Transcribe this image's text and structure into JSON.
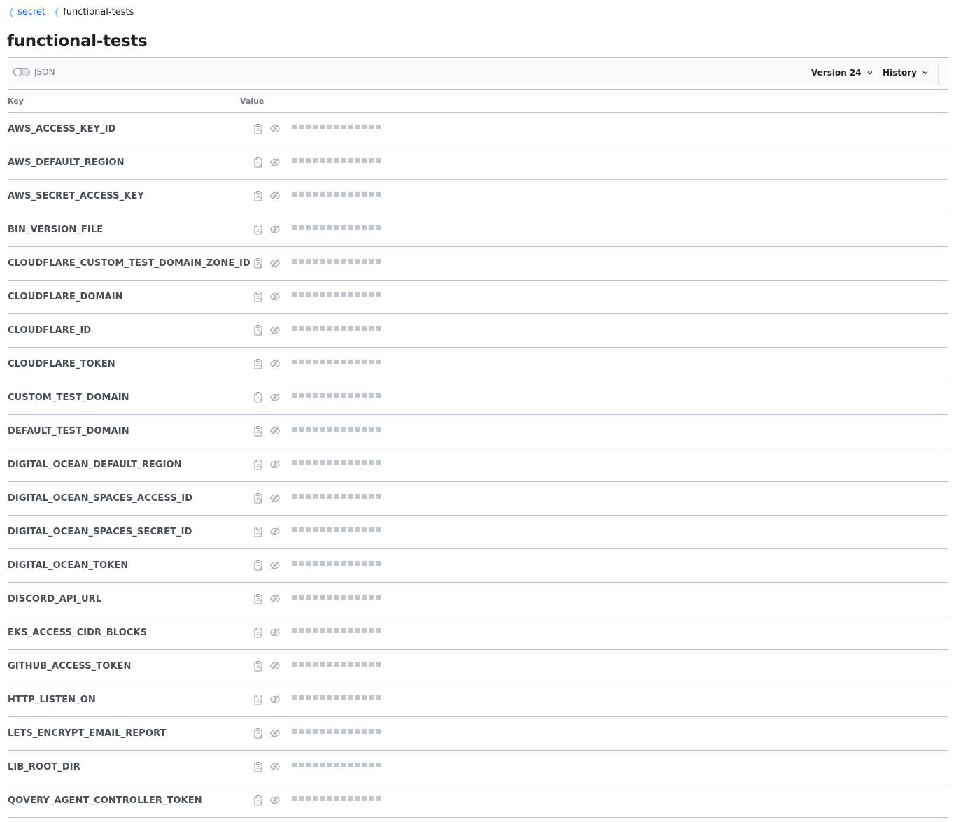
{
  "breadcrumb": [
    {
      "label": "secret",
      "link": true
    },
    {
      "label": "functional-tests",
      "link": false
    }
  ],
  "page": {
    "title": "functional-tests"
  },
  "toolbar": {
    "json_toggle_label": "JSON",
    "json_toggle_on": false,
    "version_label": "Version 24",
    "history_label": "History"
  },
  "table": {
    "key_header": "Key",
    "value_header": "Value",
    "rows": [
      {
        "key": "AWS_ACCESS_KEY_ID"
      },
      {
        "key": "AWS_DEFAULT_REGION"
      },
      {
        "key": "AWS_SECRET_ACCESS_KEY"
      },
      {
        "key": "BIN_VERSION_FILE"
      },
      {
        "key": "CLOUDFLARE_CUSTOM_TEST_DOMAIN_ZONE_ID"
      },
      {
        "key": "CLOUDFLARE_DOMAIN"
      },
      {
        "key": "CLOUDFLARE_ID"
      },
      {
        "key": "CLOUDFLARE_TOKEN"
      },
      {
        "key": "CUSTOM_TEST_DOMAIN"
      },
      {
        "key": "DEFAULT_TEST_DOMAIN"
      },
      {
        "key": "DIGITAL_OCEAN_DEFAULT_REGION"
      },
      {
        "key": "DIGITAL_OCEAN_SPACES_ACCESS_ID"
      },
      {
        "key": "DIGITAL_OCEAN_SPACES_SECRET_ID"
      },
      {
        "key": "DIGITAL_OCEAN_TOKEN"
      },
      {
        "key": "DISCORD_API_URL"
      },
      {
        "key": "EKS_ACCESS_CIDR_BLOCKS"
      },
      {
        "key": "GITHUB_ACCESS_TOKEN"
      },
      {
        "key": "HTTP_LISTEN_ON"
      },
      {
        "key": "LETS_ENCRYPT_EMAIL_REPORT"
      },
      {
        "key": "LIB_ROOT_DIR"
      },
      {
        "key": "QOVERY_AGENT_CONTROLLER_TOKEN"
      }
    ]
  },
  "icons": {
    "breadcrumb_separator": "chevron-left-icon",
    "row_copy": "clipboard-icon",
    "row_reveal": "eye-off-icon",
    "dropdown_caret": "chevron-down-icon"
  },
  "colors": {
    "link": "#1563ff",
    "mask": "#c2c6cd",
    "border": "#bac1cc"
  }
}
